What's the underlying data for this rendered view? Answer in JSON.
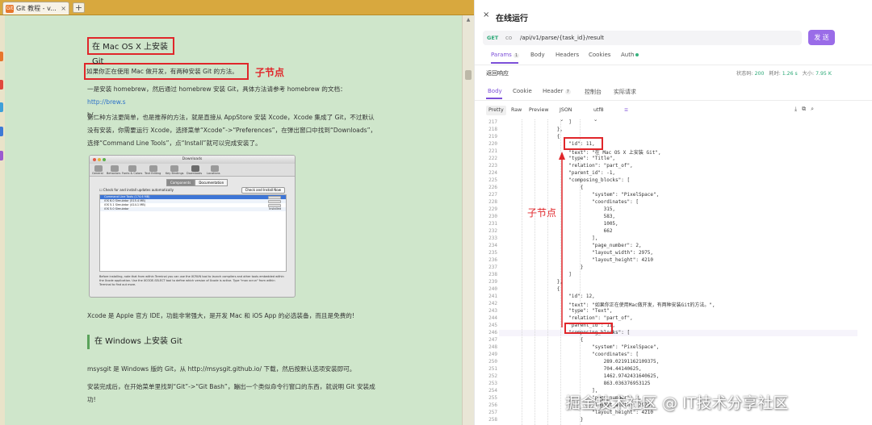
{
  "left": {
    "tab_title": "Git 教程 - v...",
    "tab_close": "×",
    "new_tab": "+",
    "favicon_label": "Git",
    "heading_mac": "在 Mac OS X 上安装 Git",
    "sub_intro": "如果你正在使用 Mac 做开发，有两种安装 Git 的方法。",
    "label_child": "子节点",
    "p1_a": "一是安装 homebrew，然后通过 homebrew 安装 Git，具体方法请参考 homebrew 的文档：",
    "p1_link": "http://brew.s",
    "p1_b": "h/。",
    "p2": "第二种方法更简单，也是推荐的方法，就是直接从 AppStore 安装 Xcode，Xcode 集成了 Git，不过默认没有安装，你需要运行 Xcode，选择菜单“Xcode”->“Preferences”，在弹出窗口中找到“Downloads”，选择“Command Line Tools”，点“Install”就可以完成安装了。",
    "p3": "Xcode 是 Apple 官方 IDE，功能非常强大，是开发 Mac 和 iOS App 的必选装备，而且是免费的!",
    "heading_win": "在 Windows 上安装 Git",
    "p4": "msysgit 是 Windows 版的 Git，从 http://msysgit.github.io/ 下载，然后按默认选项安装即可。",
    "p5": "安装完成后，在开始菜单里找到“Git”->“Git Bash”，蹦出一个类似命令行窗口的东西，就说明 Git 安装成功!",
    "screenshot": {
      "window_title": "Downloads",
      "toolbar": [
        "General",
        "Behaviors",
        "Fonts & Colors",
        "Text Editing",
        "Key Bindings",
        "Downloads",
        "Locations"
      ],
      "segments": [
        "Components",
        "Documentation"
      ],
      "check_label": "Check for and install updates automatically",
      "check_button": "Check and Install Now",
      "rows": [
        {
          "name": "Command Line Tools (174.6 MB)",
          "status": ""
        },
        {
          "name": "iOS 6.0 Simulator (515.4 MB)",
          "status": ""
        },
        {
          "name": "iOS 5.1 Simulator (414.1 MB)",
          "status": ""
        },
        {
          "name": "iOS 5.0 Simulator",
          "status": "Installed"
        }
      ],
      "desc": "Before installing, note that from within Terminal you can use the XCRUN tool to launch compilers and other tools embedded within the Xcode application. Use the XCODE-SELECT tool to define which version of Xcode is active. Type \"man xcrun\" from within Terminal to find out more."
    }
  },
  "right": {
    "close_icon": "×",
    "title": "在线运行",
    "method": "GET",
    "url_icon": "co",
    "url": "/api/v1/parse/{task_id}/result",
    "send": "发 送",
    "req_tabs": {
      "params": "Params",
      "params_badge": "1",
      "body": "Body",
      "headers": "Headers",
      "cookies": "Cookies",
      "auth": "Auth"
    },
    "response_label": "返回响应",
    "status": {
      "label": "状态码:",
      "value": "200",
      "time_label": "耗时:",
      "time": "1.26 s",
      "size_label": "大小:",
      "size": "7.95 K"
    },
    "resp_tabs": {
      "body": "Body",
      "cookie": "Cookie",
      "header": "Header",
      "header_badge": "7",
      "console": "控制台",
      "actual": "实际请求"
    },
    "view": {
      "pretty": "Pretty",
      "raw": "Raw",
      "preview": "Preview",
      "format": "JSON",
      "encoding": "utf8"
    },
    "label_child": "子节点",
    "code_lines": [
      {
        "n": "217",
        "t": "                    ]"
      },
      {
        "n": "218",
        "t": "                },"
      },
      {
        "n": "219",
        "t": "                {"
      },
      {
        "n": "220",
        "t": "                    \"id\": 11,"
      },
      {
        "n": "221",
        "t": "                    \"text\": \"在 Mac OS X 上安装 Git\","
      },
      {
        "n": "222",
        "t": "                    \"type\": \"Title\","
      },
      {
        "n": "223",
        "t": "                    \"relation\": \"part_of\","
      },
      {
        "n": "224",
        "t": "                    \"parent_id\": -1,"
      },
      {
        "n": "225",
        "t": "                    \"composing_blocks\": ["
      },
      {
        "n": "226",
        "t": "                        {"
      },
      {
        "n": "227",
        "t": "                            \"system\": \"PixelSpace\","
      },
      {
        "n": "228",
        "t": "                            \"coordinates\": ["
      },
      {
        "n": "229",
        "t": "                                315,"
      },
      {
        "n": "230",
        "t": "                                583,"
      },
      {
        "n": "231",
        "t": "                                1005,"
      },
      {
        "n": "232",
        "t": "                                662"
      },
      {
        "n": "233",
        "t": "                            ],"
      },
      {
        "n": "234",
        "t": "                            \"page_number\": 2,"
      },
      {
        "n": "235",
        "t": "                            \"layout_width\": 2975,"
      },
      {
        "n": "236",
        "t": "                            \"layout_height\": 4210"
      },
      {
        "n": "237",
        "t": "                        }"
      },
      {
        "n": "238",
        "t": "                    ]"
      },
      {
        "n": "239",
        "t": "                },"
      },
      {
        "n": "240",
        "t": "                {"
      },
      {
        "n": "241",
        "t": "                    \"id\": 12,"
      },
      {
        "n": "242",
        "t": "                    \"text\": \"如果你正在使用Mac做开发，有两种安装Git的方法。\","
      },
      {
        "n": "243",
        "t": "                    \"type\": \"Text\","
      },
      {
        "n": "244",
        "t": "                    \"relation\": \"part_of\","
      },
      {
        "n": "245",
        "t": "                    \"parent_id\": 11,"
      },
      {
        "n": "246",
        "t": "                    \"composing_blocks\": ["
      },
      {
        "n": "247",
        "t": "                        {"
      },
      {
        "n": "248",
        "t": "                            \"system\": \"PixelSpace\","
      },
      {
        "n": "249",
        "t": "                            \"coordinates\": ["
      },
      {
        "n": "250",
        "t": "                                289.02191162109375,"
      },
      {
        "n": "251",
        "t": "                                704.44140625,"
      },
      {
        "n": "252",
        "t": "                                1462.9742431640625,"
      },
      {
        "n": "253",
        "t": "                                863.036376953125"
      },
      {
        "n": "254",
        "t": "                            ],"
      },
      {
        "n": "255",
        "t": "                            \"page_number\": 2,"
      },
      {
        "n": "256",
        "t": "                            \"layout_width\": 2975,"
      },
      {
        "n": "257",
        "t": "                            \"layout_height\": 4210"
      },
      {
        "n": "258",
        "t": "                        }"
      }
    ]
  },
  "watermark": "掘金技术社区 @ IT技术分享社区",
  "colors": {
    "accent": "#7c4fd8",
    "highlight_red": "#e0262a",
    "page_green": "#cfe6cb",
    "send_button": "#9a6ce8"
  }
}
